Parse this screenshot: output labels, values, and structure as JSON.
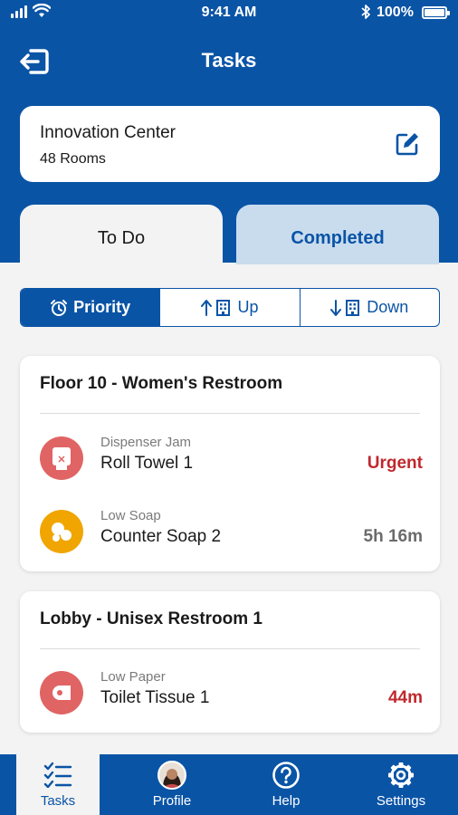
{
  "status_bar": {
    "time": "9:41 AM",
    "battery": "100%"
  },
  "header": {
    "title": "Tasks"
  },
  "building": {
    "name": "Innovation Center",
    "rooms": "48 Rooms"
  },
  "tabs": [
    {
      "label": "To Do"
    },
    {
      "label": "Completed"
    }
  ],
  "sort": [
    {
      "label": "Priority"
    },
    {
      "label": "Up"
    },
    {
      "label": "Down"
    }
  ],
  "groups": [
    {
      "title": "Floor 10 - Women's Restroom",
      "tasks": [
        {
          "kind": "Dispenser Jam",
          "name": "Roll Towel 1",
          "due": "Urgent",
          "icon": "roll-towel-icon"
        },
        {
          "kind": "Low Soap",
          "name": "Counter Soap 2",
          "due": "5h 16m",
          "icon": "soap-icon"
        }
      ]
    },
    {
      "title": "Lobby - Unisex Restroom 1",
      "tasks": [
        {
          "kind": "Low Paper",
          "name": "Toilet Tissue 1",
          "due": "44m",
          "icon": "toilet-tissue-icon"
        }
      ]
    }
  ],
  "bottom_nav": [
    {
      "label": "Tasks"
    },
    {
      "label": "Profile"
    },
    {
      "label": "Help"
    },
    {
      "label": "Settings"
    }
  ],
  "colors": {
    "primary": "#0a54a6",
    "urgent": "#c0282d",
    "time_gray": "#6b6b6b",
    "icon_red": "#e06464",
    "icon_yellow": "#f0a500",
    "completed_tab_bg": "#c9dcee"
  }
}
